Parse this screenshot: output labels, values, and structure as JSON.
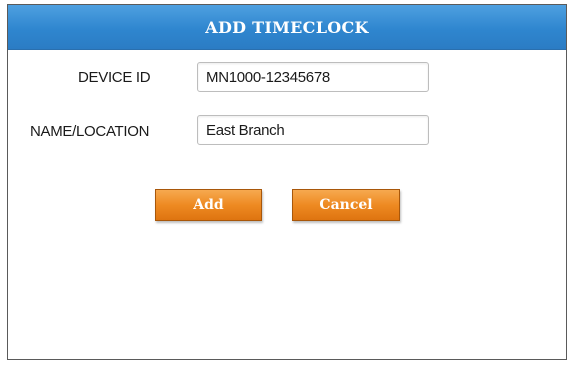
{
  "dialog": {
    "title": "ADD TIMECLOCK"
  },
  "form": {
    "device_id": {
      "label": "DEVICE ID",
      "value": "MN1000-12345678"
    },
    "name_location": {
      "label": "NAME/LOCATION",
      "value": "East Branch"
    }
  },
  "buttons": {
    "add_label": "Add",
    "cancel_label": "Cancel"
  },
  "colors": {
    "title_bar": "#2f86cf",
    "button_orange": "#ee8a22"
  }
}
